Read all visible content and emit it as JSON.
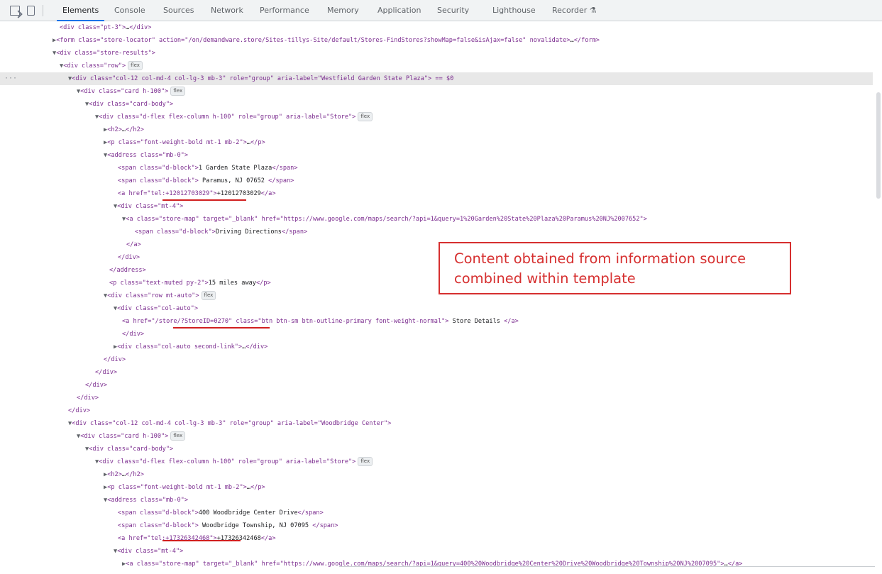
{
  "toolbar": {
    "tabs": [
      "Elements",
      "Console",
      "Sources",
      "Network",
      "Performance",
      "Memory",
      "Application",
      "Security",
      "Lighthouse",
      "Recorder ⚗"
    ],
    "active_tab": "Elements"
  },
  "dom_lines": [
    "<div class=\"pt-3\">…</div>",
    "▶<form class=\"store-locator\" action=\"/on/demandware.store/Sites-tillys-Site/default/Stores-FindStores?showMap=false&isAjax=false\" novalidate>…</form>",
    "▼<div class=\"store-results\">",
    "▼<div class=\"row\">",
    "▼<div class=\"col-12 col-md-4 col-lg-3 mb-3\" role=\"group\" aria-label=\"Westfield Garden State Plaza\"> == $0",
    "▼<div class=\"card h-100\">",
    "▼<div class=\"card-body\">",
    "▼<div class=\"d-flex flex-column h-100\" role=\"group\" aria-label=\"Store\">",
    "▶<h2>…</h2>",
    "▶<p class=\"font-weight-bold mt-1 mb-2\">…</p>",
    "▼<address class=\"mb-0\">",
    "<span class=\"d-block\">1 Garden State Plaza</span>",
    "<span class=\"d-block\"> Paramus, NJ 07652 </span>",
    "<a href=\"tel:+12012703029\">+12012703029</a>",
    "▼<div class=\"mt-4\">",
    "▼<a class=\"store-map\" target=\"_blank\" href=\"https://www.google.com/maps/search/?api=1&query=1%20Garden%20State%20Plaza%20Paramus%20NJ%2007652\">",
    "<span class=\"d-block\">Driving Directions</span>",
    "</a>",
    "</div>",
    "</address>",
    "<p class=\"text-muted py-2\">15 miles away</p>",
    "▼<div class=\"row mt-auto\">",
    "▼<div class=\"col-auto\">",
    "<a href=\"/store/?StoreID=0270\" class=\"btn btn-sm btn-outline-primary font-weight-normal\"> Store Details </a>",
    "</div>",
    "▶<div class=\"col-auto second-link\">…</div>",
    "</div>",
    "</div>",
    "</div>",
    "</div>",
    "</div>",
    "▼<div class=\"col-12 col-md-4 col-lg-3 mb-3\" role=\"group\" aria-label=\"Woodbridge Center\">",
    "▼<div class=\"card h-100\">",
    "▼<div class=\"card-body\">",
    "▼<div class=\"d-flex flex-column h-100\" role=\"group\" aria-label=\"Store\">",
    "▶<h2>…</h2>",
    "▶<p class=\"font-weight-bold mt-1 mb-2\">…</p>",
    "▼<address class=\"mb-0\">",
    "<span class=\"d-block\">400 Woodbridge Center Drive</span>",
    "<span class=\"d-block\"> Woodbridge Township, NJ 07095 </span>",
    "<a href=\"tel:+17326342468\">+17326342468</a>",
    "▼<div class=\"mt-4\">",
    "▶<a class=\"store-map\" target=\"_blank\" href=\"https://www.google.com/maps/search/?api=1&query=400%20Woodbridge%20Center%20Drive%20Woodbridge%20Township%20NJ%2007095\">…</a>"
  ],
  "flex_badge": "flex",
  "selected_marker": "···",
  "callout": {
    "text": "Content obtained from information source\ncombined within template"
  },
  "colors": {
    "accent": "#1a73e8",
    "annotation": "#d62f2f"
  }
}
